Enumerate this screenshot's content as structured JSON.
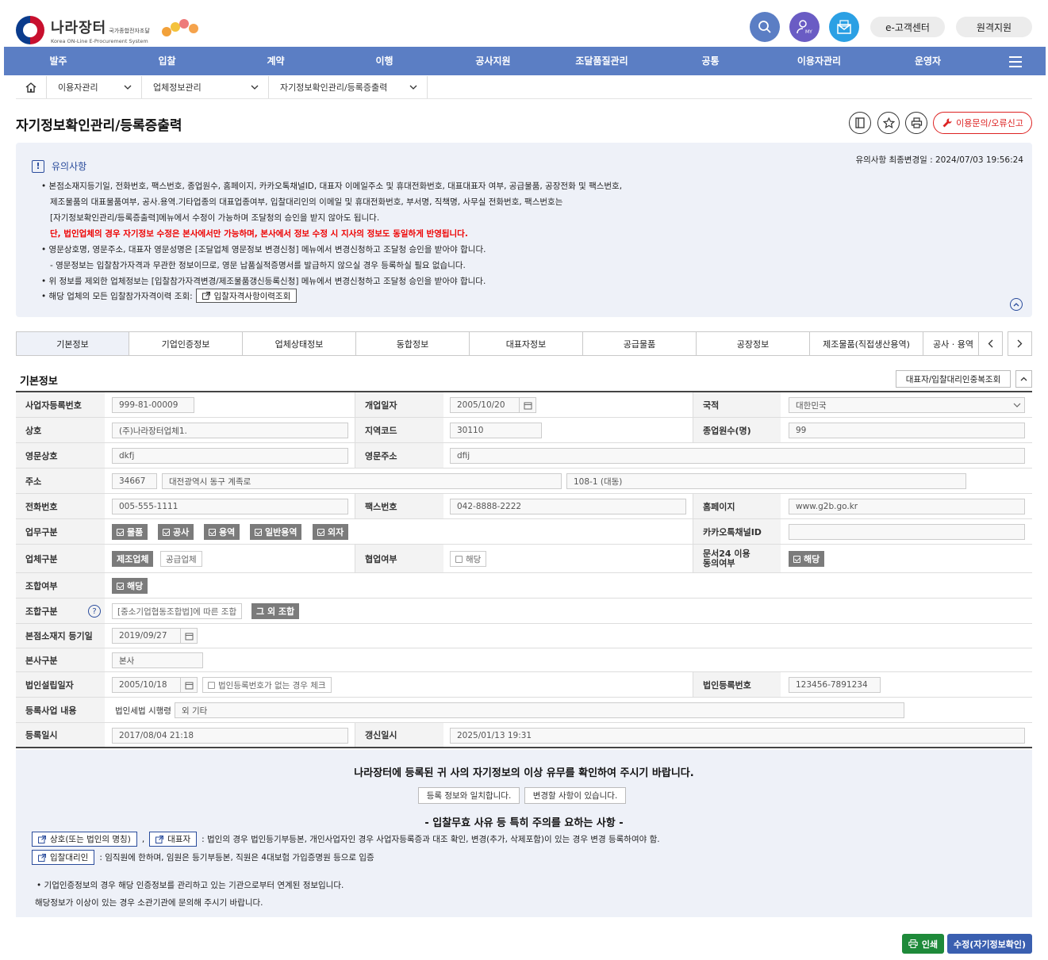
{
  "header": {
    "logo_main": "나라장터",
    "logo_tag": "국가종합전자조달",
    "logo_sub": "Korea ON-Line E-Procurement System",
    "icons": [
      "search-icon",
      "my-icon",
      "mail-icon"
    ],
    "my_label": "MY",
    "customer_center": "e-고객센터",
    "remote_support": "원격지원"
  },
  "gnb": [
    "발주",
    "입찰",
    "계약",
    "이행",
    "공사지원",
    "조달품질관리",
    "공통",
    "이용자관리",
    "운영자"
  ],
  "breadcrumb": [
    "이용자관리",
    "업체정보관리",
    "자기정보확인관리/등록증출력"
  ],
  "page": {
    "title": "자기정보확인관리/등록증출력",
    "report_btn": "이용문의/오류신고"
  },
  "notice": {
    "title": "유의사항",
    "date_label": "유의사항 최종변경일 : 2024/07/03 19:56:24",
    "lines": [
      "• 본점소재지등기일, 전화번호, 팩스번호, 종업원수, 홈페이지, 카카오톡채널ID, 대표자 이메일주소 및 휴대전화번호, 대표대표자 여부, 공급물품, 공장전화 및 팩스번호,",
      "제조물품의 대표물품여부, 공사.용역.기타업종의 대표업종여부, 입찰대리인의 이메일 및 휴대전화번호, 부서명, 직책명, 사무실 전화번호, 팩스번호는",
      "[자기정보확인관리/등록증출력]메뉴에서 수정이 가능하며 조달청의 승인을 받지 않아도 됩니다.",
      "단, 법인업체의 경우 자기정보 수정은 본사에서만 가능하며, 본사에서 정보 수정 시 지사의 정보도 동일하게 반영됩니다.",
      "• 영문상호명, 영문주소, 대표자 영문성명은 [조달업체 영문정보 변경신청] 메뉴에서 변경신청하고 조달청 승인을 받아야 합니다.",
      "- 영문정보는 입찰참가자격과 무관한 정보이므로, 영문 납품실적증명서를 발급하지 않으실 경우 등록하실 필요 없습니다.",
      "• 위 정보를 제외한 업체정보는 [입찰참가자격변경/제조물품갱신등록신청] 메뉴에서 변경신청하고 조달청 승인을 받아야 합니다.",
      "• 해당 업체의 모든 입찰참가자격이력 조회:"
    ],
    "history_btn": "입찰자격사항이력조회"
  },
  "tabs": [
    "기본정보",
    "기업인증정보",
    "업체상태정보",
    "동합정보",
    "대표자정보",
    "공급물품",
    "공장정보",
    "제조물품(직접생산용역)",
    "공사 · 용역"
  ],
  "section": {
    "title": "기본정보",
    "dup_btn": "대표자/입찰대리인중복조회"
  },
  "form": {
    "biz_no_label": "사업자등록번호",
    "biz_no": "999-81-00009",
    "open_date_label": "개업일자",
    "open_date": "2005/10/20",
    "nation_label": "국적",
    "nation": "대한민국",
    "name_label": "상호",
    "name": "(주)나라장터업체1.",
    "region_label": "지역코드",
    "region": "30110",
    "employees_label": "종업원수(명)",
    "employees": "99",
    "en_name_label": "영문상호",
    "en_name": "dkfj",
    "en_addr_label": "영문주소",
    "en_addr": "dfij",
    "addr_label": "주소",
    "zip": "34667",
    "addr1": "대전광역시 동구 계족로",
    "addr2": "108-1 (대동)",
    "tel_label": "전화번호",
    "tel": "005-555-1111",
    "fax_label": "팩스번호",
    "fax": "042-8888-2222",
    "homepage_label": "홈페이지",
    "homepage": "www.g2b.go.kr",
    "work_label": "업무구분",
    "work": [
      "물품",
      "공사",
      "용역",
      "일반용역",
      "외자"
    ],
    "kakao_label": "카카오톡채널ID",
    "kakao": "",
    "type_label": "업체구분",
    "type_on": "제조업체",
    "type_off": "공급업체",
    "coop_label": "협업여부",
    "coop": "해당",
    "doc24_label1": "문서24 이용",
    "doc24_label2": "동의여부",
    "doc24": "해당",
    "union_label": "조합여부",
    "union": "해당",
    "union_type_label": "조합구분",
    "union_type_off": "[중소기업협동조합법]에 따른 조합",
    "union_type_on": "그 외 조합",
    "help": "?",
    "hq_reg_label": "본점소재지 등기일",
    "hq_reg": "2019/09/27",
    "hq_type_label": "본사구분",
    "hq_type": "본사",
    "corp_date_label": "법인설립일자",
    "corp_date": "2005/10/18",
    "no_corp_check": "법인등록번호가 없는 경우 체크",
    "corp_no_label": "법인등록번호",
    "corp_no": "123456-7891234",
    "biz_content_label": "등록사업 내용",
    "biz_content_pre": "법인세법 시행령",
    "biz_content": "외 기타",
    "reg_date_label": "등록일시",
    "reg_date": "2017/08/04 21:18",
    "renew_label": "갱신일시",
    "renew": "2025/01/13 19:31"
  },
  "confirm": {
    "title": "나라장터에 등록된 귀 사의 자기정보의 이상 유무를 확인하여 주시기 바랍니다.",
    "btn_ok": "등록 정보와 일치합니다.",
    "btn_change": "변경할 사항이 있습니다.",
    "warn": "- 입찰무효 사유 등 특히 주의를 요하는 사항 -",
    "link1": "상호(또는 법인의 명칭)",
    "comma": ",",
    "link2": "대표자",
    "line1": ": 법인의 경우 법인등기부등본, 개인사업자인 경우 사업자등록증과 대조 확인, 변경(추가, 삭제포함)이 있는 경우 변경 등록하여야 함.",
    "link3": "입찰대리인",
    "line2": ": 임직원에 한하며, 임원은 등기부등본, 직원은 4대보험 가입증명원 등으로 입증",
    "note1": "• 기업인증정보의 경우 해당 인증정보를 관리하고 있는 기관으로부터 연계된 정보입니다.",
    "note2": "해당정보가 이상이 있는 경우 소관기관에 문의해 주시기 바랍니다."
  },
  "footer": {
    "print": "인쇄",
    "edit": "수정(자기정보확인)"
  },
  "colors": {
    "gnb": "#5b7ec4",
    "accent_blue": "#2a4c9c",
    "notice_bg": "#eef1f8",
    "print_green": "#1e8a3a",
    "edit_blue": "#3a5fb0",
    "alert_red": "#e00000"
  }
}
